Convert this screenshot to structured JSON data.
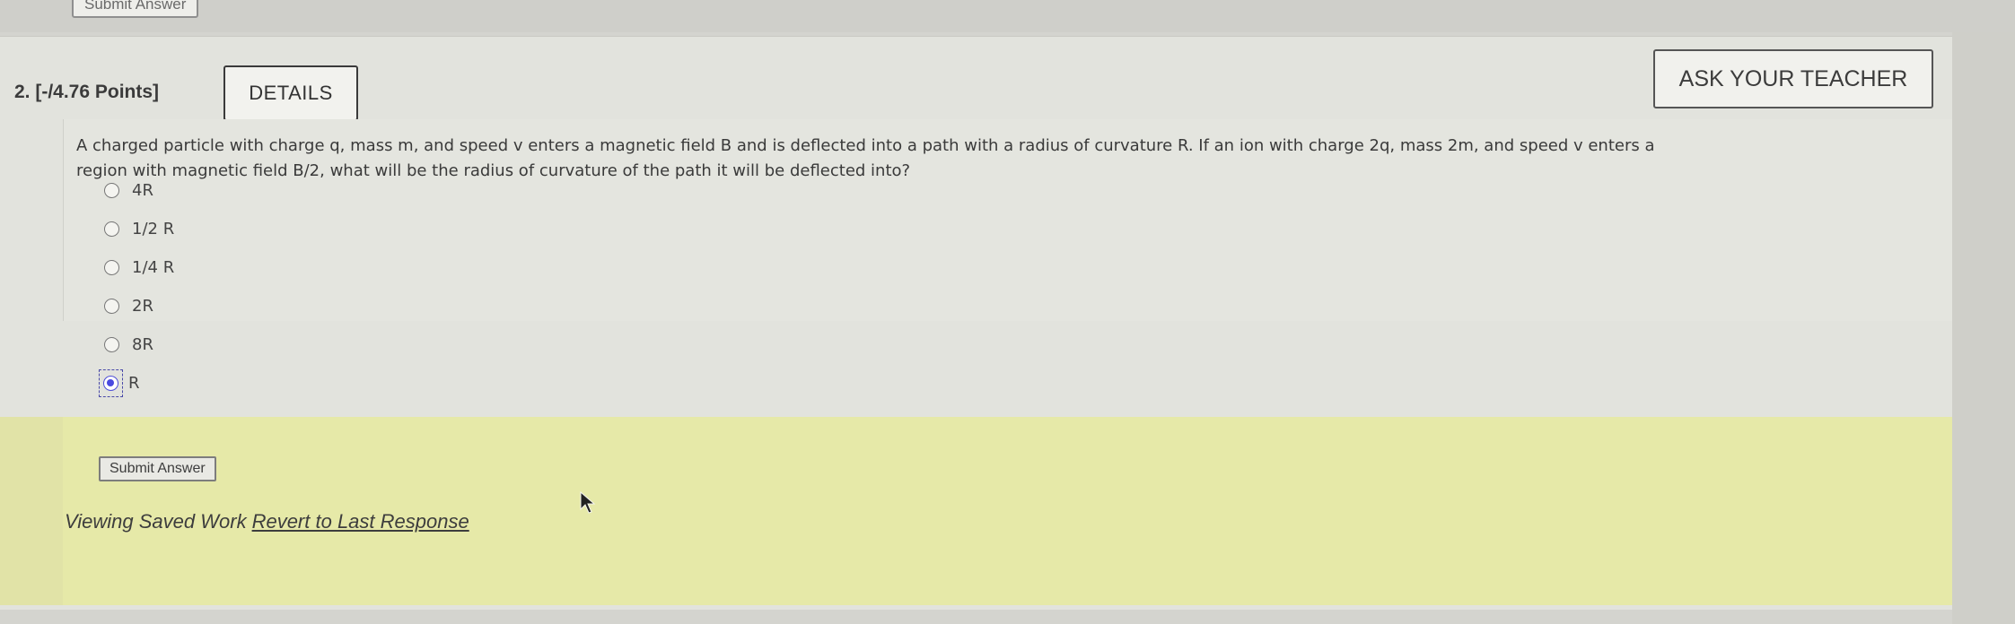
{
  "previous": {
    "submit_label": "Submit Answer"
  },
  "question": {
    "number_points": "2.  [-/4.76 Points]",
    "details_label": "DETAILS",
    "ask_teacher_label": "ASK YOUR TEACHER",
    "text_line1": "A charged particle with charge q, mass m, and speed v enters a magnetic field B and is deflected into a path with a radius of curvature R. If an ion with charge 2q, mass 2m, and speed v enters a",
    "text_line2": "region with magnetic field B/2, what will be the radius of curvature of the path it will be deflected into?",
    "options": [
      {
        "label": "4R",
        "selected": false
      },
      {
        "label": "1/2 R",
        "selected": false
      },
      {
        "label": "1/4 R",
        "selected": false
      },
      {
        "label": "2R",
        "selected": false
      },
      {
        "label": "8R",
        "selected": false
      },
      {
        "label": "R",
        "selected": true
      }
    ]
  },
  "answer_area": {
    "submit_label": "Submit Answer",
    "viewing_saved_text": "Viewing Saved Work",
    "revert_link": "Revert to Last Response"
  },
  "colors": {
    "answer_bg": "#e6e9a8",
    "card_bg": "#e2e3dd",
    "selected_radio": "#4a4ae0"
  }
}
